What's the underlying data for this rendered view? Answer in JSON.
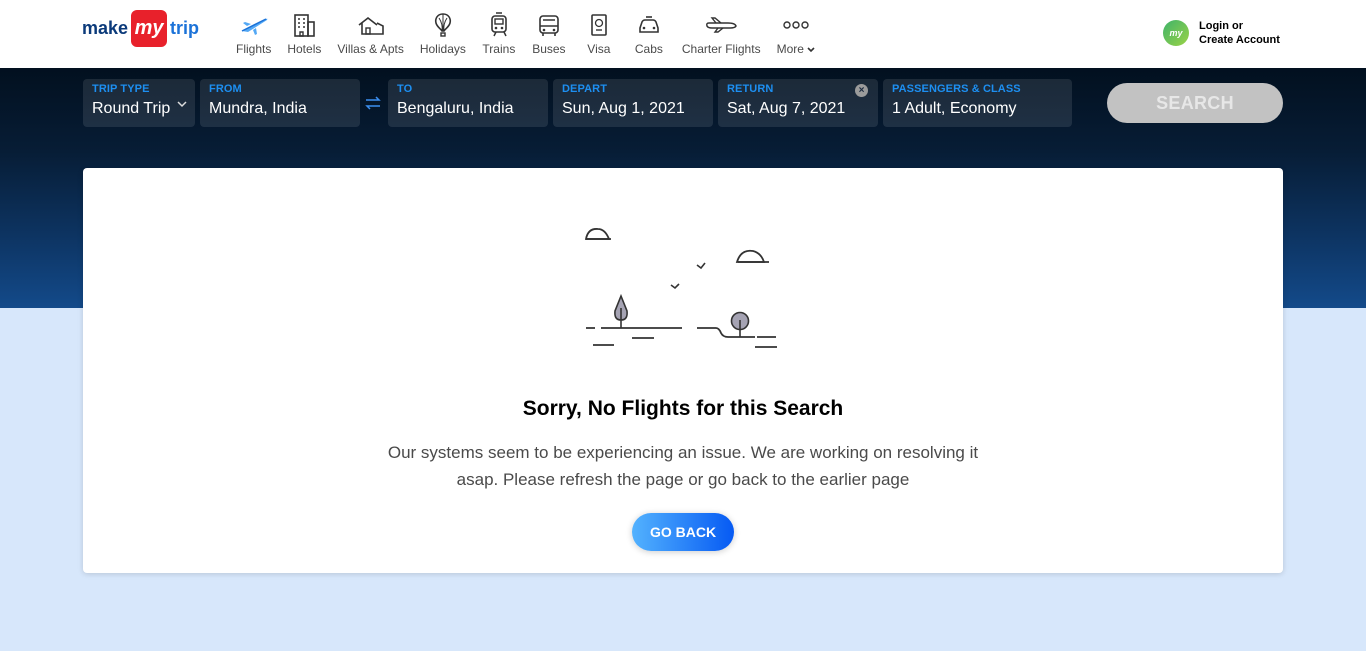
{
  "logo": {
    "part1": "make",
    "part2": "my",
    "part3": "trip"
  },
  "nav": [
    {
      "label": "Flights",
      "icon": "plane-icon"
    },
    {
      "label": "Hotels",
      "icon": "hotel-icon"
    },
    {
      "label": "Villas & Apts",
      "icon": "villa-icon"
    },
    {
      "label": "Holidays",
      "icon": "balloon-icon"
    },
    {
      "label": "Trains",
      "icon": "train-icon"
    },
    {
      "label": "Buses",
      "icon": "bus-icon"
    },
    {
      "label": "Visa",
      "icon": "passport-icon"
    },
    {
      "label": "Cabs",
      "icon": "car-icon"
    },
    {
      "label": "Charter Flights",
      "icon": "jet-icon"
    },
    {
      "label": "More",
      "icon": "more-icon"
    }
  ],
  "login": {
    "avatar": "my",
    "line1": "Login or",
    "line2": "Create Account"
  },
  "search": {
    "trip_type": {
      "label": "TRIP TYPE",
      "value": "Round Trip"
    },
    "from": {
      "label": "FROM",
      "value": "Mundra, India"
    },
    "to": {
      "label": "TO",
      "value": "Bengaluru, India"
    },
    "depart": {
      "label": "DEPART",
      "value": "Sun, Aug 1, 2021"
    },
    "return": {
      "label": "RETURN",
      "value": "Sat, Aug 7, 2021"
    },
    "passengers": {
      "label": "PASSENGERS & CLASS",
      "value": "1 Adult, Economy"
    },
    "button": "SEARCH"
  },
  "error": {
    "title": "Sorry, No Flights for this Search",
    "message": "Our systems seem to be experiencing an issue. We are working on resolving it asap. Please refresh the page or go back to the earlier page",
    "button": "GO BACK"
  },
  "colors": {
    "accent": "#1d8ff1",
    "brand_red": "#e8212b",
    "band_dark": "#02101f",
    "page_bg": "#d7e7fb"
  }
}
